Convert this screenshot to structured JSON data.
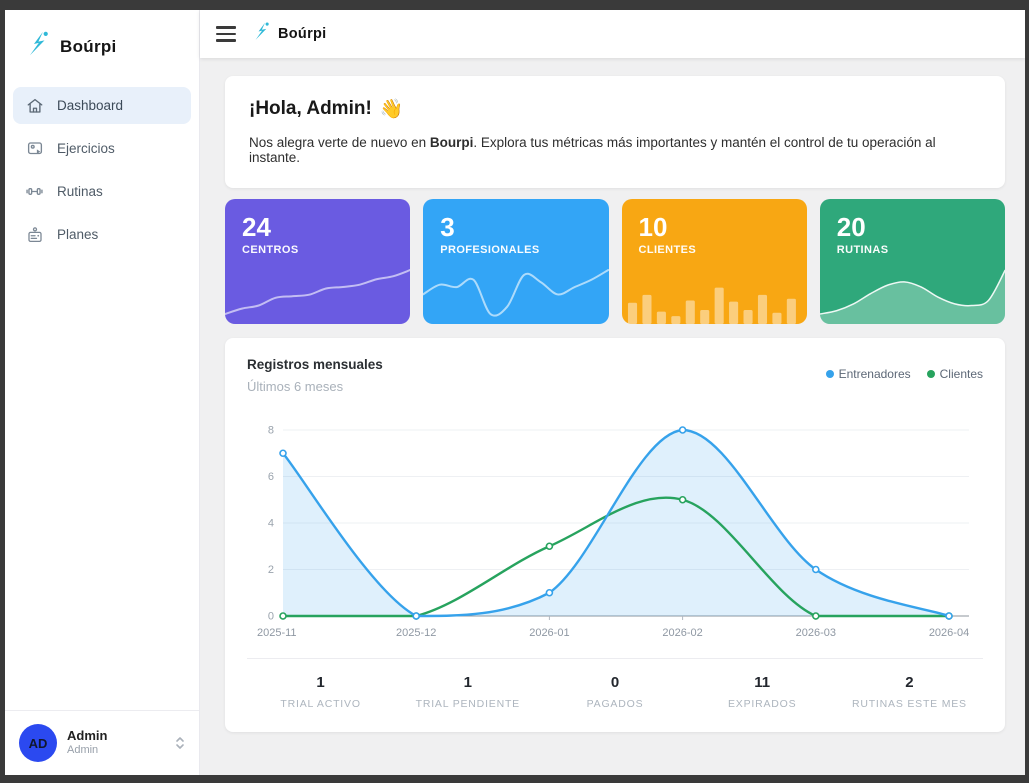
{
  "brand": {
    "name": "Boúrpi",
    "color": "#2fb9d8"
  },
  "sidebar": {
    "items": [
      {
        "label": "Dashboard",
        "icon": "home-icon",
        "active": true
      },
      {
        "label": "Ejercicios",
        "icon": "media-icon",
        "active": false
      },
      {
        "label": "Rutinas",
        "icon": "dumbbell-icon",
        "active": false
      },
      {
        "label": "Planes",
        "icon": "id-card-icon",
        "active": false
      }
    ],
    "user": {
      "initials": "AD",
      "name": "Admin",
      "role": "Admin"
    }
  },
  "welcome": {
    "title": "¡Hola, Admin!",
    "emoji": "👋",
    "body_prefix": "Nos alegra verte de nuevo en ",
    "brand_bold": "Bourpi",
    "body_suffix": ". Explora tus métricas más importantes y mantén el control de tu operación al instante."
  },
  "stat_cards": [
    {
      "value": "24",
      "label": "CENTROS",
      "color": "#6a5be1",
      "spark_type": "line",
      "spark": [
        0.5,
        1.2,
        1.6,
        2.6,
        2.8,
        3.0,
        3.8,
        4.0,
        4.3,
        5.0,
        5.4,
        6.2
      ]
    },
    {
      "value": "3",
      "label": "PROFESIONALES",
      "color": "#33a5f6",
      "spark_type": "line",
      "spark": [
        2.6,
        2.8,
        2.75,
        2.9,
        2.2,
        2.35,
        3.0,
        2.85,
        2.6,
        2.75,
        2.9,
        3.1
      ]
    },
    {
      "value": "10",
      "label": "CLIENTES",
      "color": "#f8a713",
      "spark_type": "bars",
      "spark": [
        38,
        52,
        22,
        14,
        42,
        25,
        65,
        40,
        25,
        52,
        20,
        45
      ]
    },
    {
      "value": "20",
      "label": "RUTINAS",
      "color": "#2fa87b",
      "spark_type": "area",
      "spark": [
        3.3,
        3.4,
        3.6,
        3.9,
        4.15,
        4.25,
        4.1,
        3.8,
        3.6,
        3.55,
        3.7,
        4.6
      ]
    }
  ],
  "chart_card": {
    "title": "Registros mensuales",
    "subtitle": "Últimos 6 meses",
    "legend": [
      {
        "label": "Entrenadores",
        "color": "#36a2eb"
      },
      {
        "label": "Clientes",
        "color": "#27a35e"
      }
    ]
  },
  "chart_data": {
    "type": "line",
    "x": [
      "2025-11",
      "2025-12",
      "2026-01",
      "2026-02",
      "2026-03",
      "2026-04"
    ],
    "series": [
      {
        "name": "Entrenadores",
        "color": "#36a2eb",
        "fill": "rgba(54,162,235,0.16)",
        "values": [
          7,
          0,
          1,
          8,
          2,
          0
        ]
      },
      {
        "name": "Clientes",
        "color": "#27a35e",
        "fill": null,
        "values": [
          0,
          0,
          3,
          5,
          0,
          0
        ]
      }
    ],
    "ylim": [
      0,
      8
    ],
    "yticks": [
      0,
      2,
      4,
      6,
      8
    ],
    "grid": true,
    "legend_position": "top-right",
    "smooth": true
  },
  "mini_stats": [
    {
      "value": "1",
      "label": "TRIAL ACTIVO"
    },
    {
      "value": "1",
      "label": "TRIAL PENDIENTE"
    },
    {
      "value": "0",
      "label": "PAGADOS"
    },
    {
      "value": "11",
      "label": "EXPIRADOS"
    },
    {
      "value": "2",
      "label": "RUTINAS ESTE MES"
    }
  ]
}
